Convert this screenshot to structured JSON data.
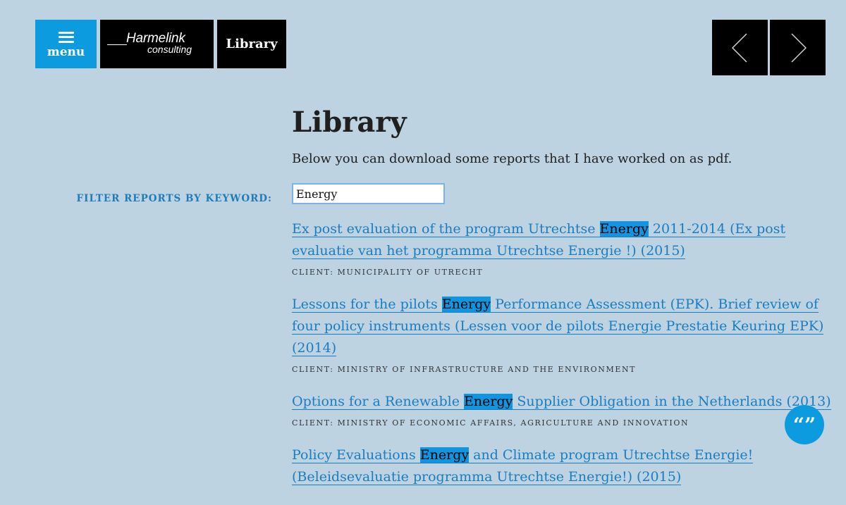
{
  "header": {
    "menu_label": "menu",
    "logo_name": "Harmelink",
    "logo_sub": "consulting",
    "section_badge": "Library"
  },
  "main": {
    "title": "Library",
    "intro": "Below you can download some reports that I have worked on as pdf."
  },
  "filter": {
    "label": "Filter reports by keyword:",
    "value": "Energy"
  },
  "reports": [
    {
      "title_before": "Ex post evaluation of the program Utrechtse ",
      "highlight": "Energy",
      "title_after": " 2011-2014 (Ex post evaluatie van het programma Utrechtse Energie !) (2015)",
      "client": "Client: Municipality of Utrecht"
    },
    {
      "title_before": "Lessons for the pilots ",
      "highlight": "Energy",
      "title_after": " Performance Assessment (EPK). Brief review of four policy instruments (Lessen voor de pilots Energie Prestatie Keuring EPK) (2014)",
      "client": "Client: Ministry of Infrastructure and the Environment"
    },
    {
      "title_before": "Options for a Renewable ",
      "highlight": "Energy",
      "title_after": " Supplier Obligation in the Netherlands (2013)",
      "client": "Client: Ministry of Economic Affairs, Agriculture and Innovation"
    },
    {
      "title_before": "Policy Evaluations ",
      "highlight": "Energy",
      "title_after": " and Climate program Utrechtse Energie! (Beleidsevaluatie programma Utrechtse Energie!) (2015)",
      "client": ""
    }
  ],
  "chat": {
    "glyph": "“”"
  },
  "icons": {
    "menu": "hamburger-icon",
    "prev": "chevron-left-icon",
    "next": "chevron-right-icon",
    "chat": "quote-icon"
  },
  "colors": {
    "background": "#bdd3e2",
    "accent": "#0d9be0",
    "link": "#1a7dc0",
    "highlight": "#1195e0"
  }
}
